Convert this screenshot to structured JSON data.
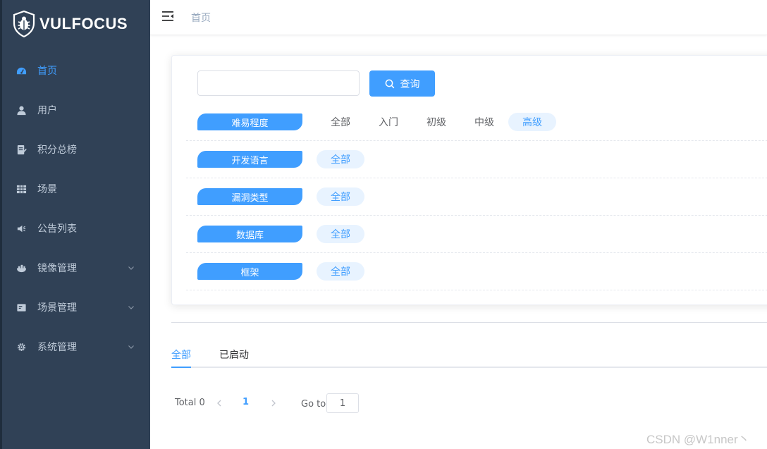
{
  "brand": {
    "name": "VULFOCUS"
  },
  "sidebar": {
    "items": [
      {
        "label": "首页",
        "icon": "dashboard-icon",
        "active": true
      },
      {
        "label": "用户",
        "icon": "user-icon"
      },
      {
        "label": "积分总榜",
        "icon": "ranking-icon"
      },
      {
        "label": "场景",
        "icon": "grid-icon"
      },
      {
        "label": "公告列表",
        "icon": "speaker-icon"
      },
      {
        "label": "镜像管理",
        "icon": "image-icon",
        "expandable": true
      },
      {
        "label": "场景管理",
        "icon": "scene-icon",
        "expandable": true
      },
      {
        "label": "系统管理",
        "icon": "gear-icon",
        "expandable": true
      }
    ]
  },
  "header": {
    "breadcrumb": "首页"
  },
  "search": {
    "value": "",
    "placeholder": "",
    "button_label": "查询"
  },
  "filters": [
    {
      "label": "难易程度",
      "options": [
        "全部",
        "入门",
        "初级",
        "中级",
        "高级"
      ],
      "selected": "高级"
    },
    {
      "label": "开发语言",
      "options": [
        "全部"
      ],
      "selected": "全部"
    },
    {
      "label": "漏洞类型",
      "options": [
        "全部"
      ],
      "selected": "全部"
    },
    {
      "label": "数据库",
      "options": [
        "全部"
      ],
      "selected": "全部"
    },
    {
      "label": "框架",
      "options": [
        "全部"
      ],
      "selected": "全部"
    }
  ],
  "tabs": [
    {
      "label": "全部",
      "active": true
    },
    {
      "label": "已启动"
    }
  ],
  "pagination": {
    "total": "Total 0",
    "current_page": "1",
    "goto_label": "Go to",
    "goto_value": "1"
  },
  "watermark": "CSDN @W1nner丶",
  "colors": {
    "sidebar": "#304156",
    "accent": "#409eff",
    "menu_text": "#bfcbd9"
  }
}
